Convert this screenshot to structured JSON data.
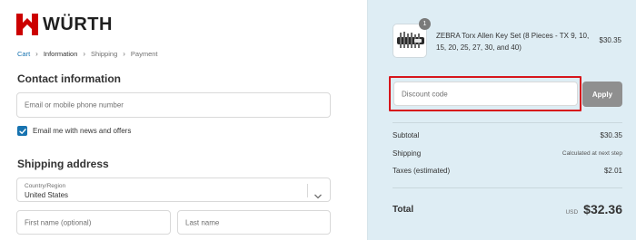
{
  "brand": {
    "name": "WÜRTH",
    "accent": "#cc0000"
  },
  "breadcrumb": [
    {
      "label": "Cart",
      "state": "link"
    },
    {
      "label": "Information",
      "state": "current"
    },
    {
      "label": "Shipping",
      "state": "upcoming"
    },
    {
      "label": "Payment",
      "state": "upcoming"
    }
  ],
  "breadcrumb_separator": "›",
  "contact": {
    "title": "Contact information",
    "email_placeholder": "Email or mobile phone number",
    "newsletter_label": "Email me with news and offers",
    "newsletter_checked": true
  },
  "shipping": {
    "title": "Shipping address",
    "country_label": "Country/Region",
    "country_value": "United States",
    "first_name_placeholder": "First name (optional)",
    "last_name_placeholder": "Last name"
  },
  "order": {
    "item": {
      "quantity": "1",
      "name": "ZEBRA Torx Allen Key Set (8 Pieces - TX 9, 10, 15, 20, 25, 27, 30, and 40)",
      "price": "$30.35",
      "image_icon": "allen-key-set-icon"
    },
    "discount_placeholder": "Discount code",
    "apply_label": "Apply",
    "subtotal_label": "Subtotal",
    "subtotal_value": "$30.35",
    "shipping_label": "Shipping",
    "shipping_value": "Calculated at next step",
    "taxes_label": "Taxes (estimated)",
    "taxes_value": "$2.01",
    "total_label": "Total",
    "total_currency": "USD",
    "total_value": "$32.36"
  },
  "colors": {
    "link": "#1773b0",
    "summary_bg": "#deedf4",
    "highlight": "#d7151b",
    "apply_bg": "#8f8f8f"
  }
}
